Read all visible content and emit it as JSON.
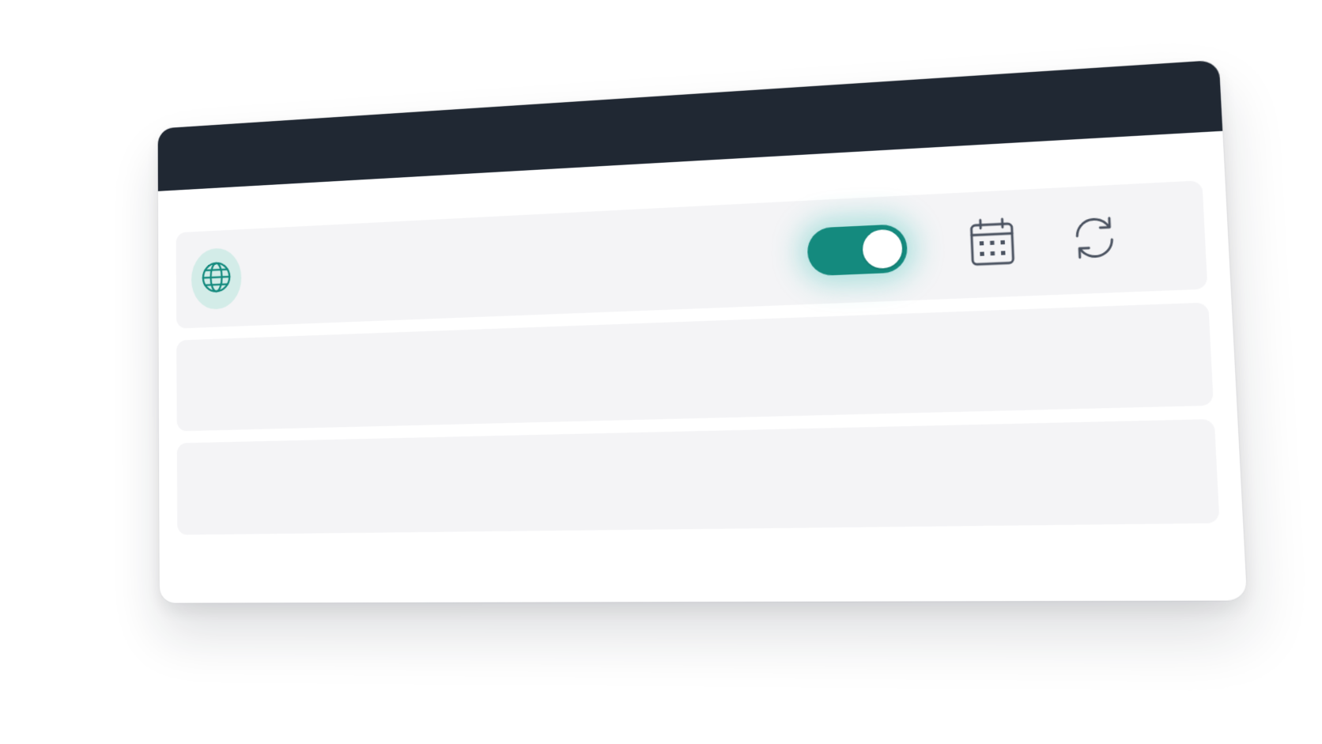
{
  "window": {
    "titlebar_color": "#202833"
  },
  "toolbar": {
    "globe_icon": "globe-icon",
    "toggle": {
      "state": "on",
      "color": "#148a7e"
    },
    "calendar_icon": "calendar-icon",
    "refresh_icon": "refresh-icon"
  },
  "rows": [
    {
      "content": ""
    },
    {
      "content": ""
    }
  ],
  "colors": {
    "accent": "#148a7e",
    "accent_glow": "#2cbeb2",
    "row_bg": "#f4f4f6",
    "icon_gray": "#4a5260"
  }
}
